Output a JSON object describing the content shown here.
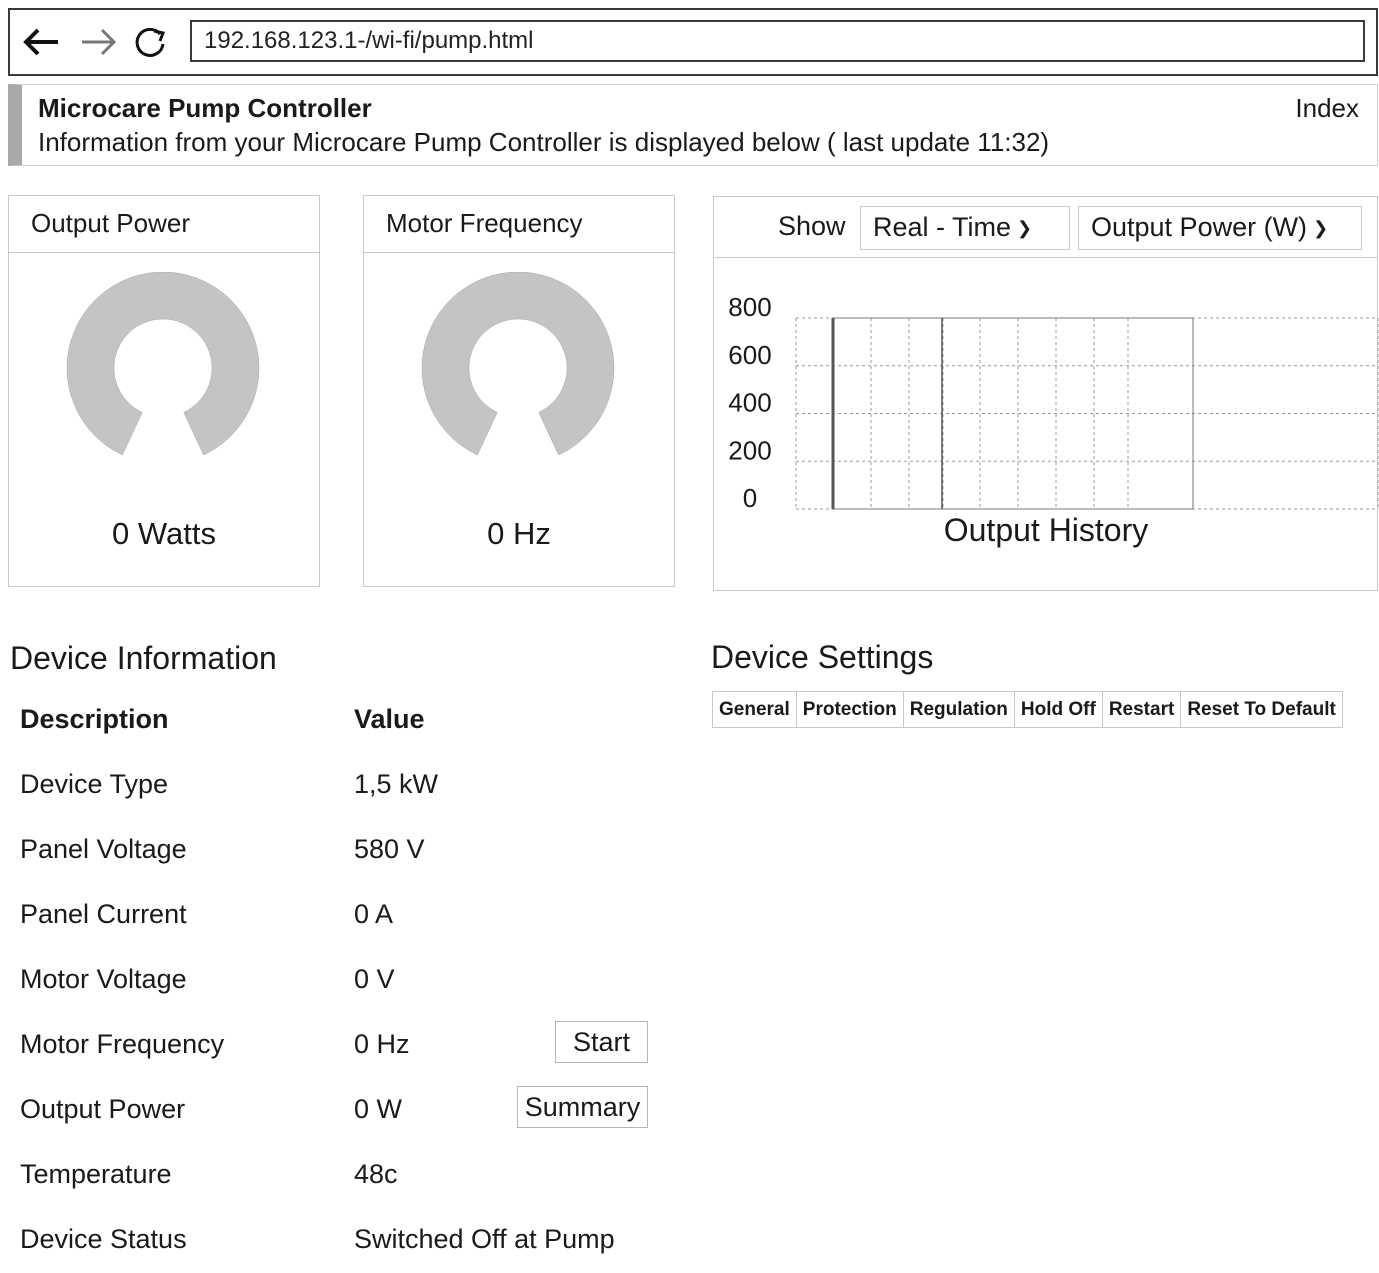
{
  "browser": {
    "url": "192.168.123.1-/wi-fi/pump.html"
  },
  "header": {
    "title": "Microcare Pump Controller",
    "subtitle": "Information from your Microcare Pump Controller is displayed below ( last update 11:32)",
    "index_link": "Index"
  },
  "gauges": {
    "output_power": {
      "title": "Output Power",
      "value": "0 Watts",
      "level": 0
    },
    "motor_frequency": {
      "title": "Motor Frequency",
      "value": "0 Hz",
      "level": 0
    }
  },
  "chart_panel": {
    "show_label": "Show",
    "range_select": "Real - Time",
    "metric_select": "Output Power (W)"
  },
  "chart_data": {
    "type": "line",
    "title": "Output History",
    "xlabel": "",
    "ylabel": "",
    "y_ticks": [
      "800",
      "600",
      "400",
      "200",
      "0"
    ],
    "ylim": [
      0,
      800
    ],
    "grid": true,
    "series": []
  },
  "device_info": {
    "title": "Device Information",
    "col_description": "Description",
    "col_value": "Value",
    "rows": [
      {
        "description": "Device Type",
        "value": "1,5 kW"
      },
      {
        "description": "Panel Voltage",
        "value": "580 V"
      },
      {
        "description": "Panel Current",
        "value": "0  A"
      },
      {
        "description": "Motor Voltage",
        "value": "0 V"
      },
      {
        "description": "Motor Frequency",
        "value": "0 Hz"
      },
      {
        "description": "Output Power",
        "value": "0 W"
      },
      {
        "description": "Temperature",
        "value": "48c"
      },
      {
        "description": "Device Status",
        "value": "Switched Off at Pump"
      }
    ],
    "start_button": "Start",
    "summary_button": "Summary"
  },
  "device_settings": {
    "title": "Device Settings",
    "tabs": [
      "General",
      "Protection",
      "Regulation",
      "Hold Off",
      "Restart",
      "Reset To Default"
    ]
  },
  "colors": {
    "gauge_fill": "#c4c4c4",
    "border": "#c9c9c9",
    "header_accent": "#a8a8a8"
  }
}
